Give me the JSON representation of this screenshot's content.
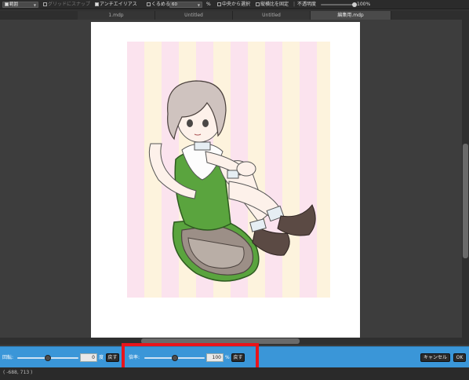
{
  "toolbar": {
    "mode_select": "範囲",
    "snap_grid_label": "グリッドにスナップ",
    "antialias_label": "アンチエイリアス",
    "contain_label": "くるめる",
    "contain_value": "60",
    "contain_unit": "%",
    "center_select_label": "中央から選択",
    "aspect_label": "縦横比を固定",
    "opacity_label": "不透明度",
    "opacity_value": "100%",
    "opacity_level": 1.0
  },
  "tabs": [
    {
      "label": "1.mdp",
      "active": false
    },
    {
      "label": "Untitled",
      "active": false
    },
    {
      "label": "Untitled",
      "active": false
    },
    {
      "label": "編集用.mdp",
      "active": true
    }
  ],
  "artwork": {
    "stripe_colors": [
      "#fbe3ee",
      "#fdf3dd"
    ],
    "hair_color": "#cfc3bf",
    "skin_color": "#fdf1ea",
    "dress_color": "#5aa43e",
    "skirt_color": "#9c8f87",
    "boot_color": "#5b4a44"
  },
  "transform_bar": {
    "rotate_label": "回転:",
    "rotate_value": "0",
    "rotate_unit": "度",
    "rotate_reset": "戻す",
    "scale_label": "倍率:",
    "scale_value": "100",
    "scale_unit": "%",
    "scale_reset": "戻す",
    "cancel_label": "キャンセル",
    "ok_label": "OK",
    "accent_color": "#3a96d8",
    "highlight_color": "#e8141b"
  },
  "status": {
    "coords": "( -688, 713 )"
  }
}
